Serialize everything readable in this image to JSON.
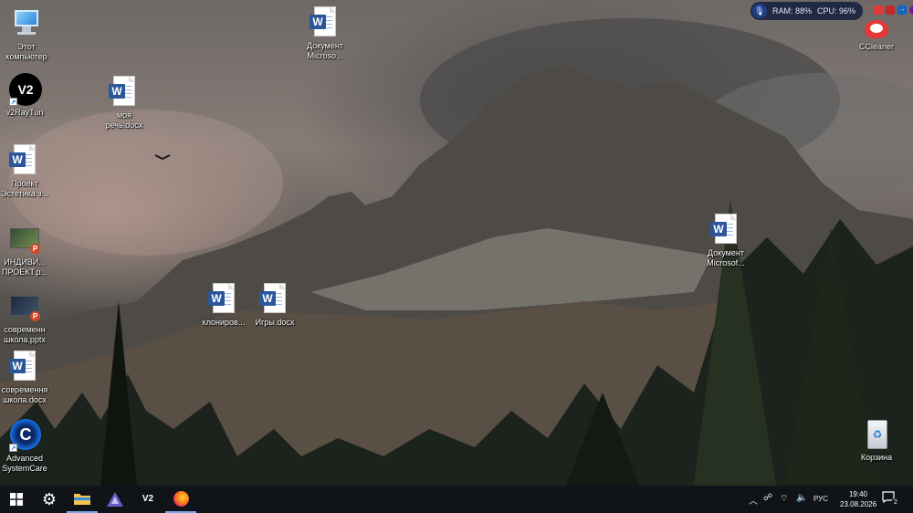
{
  "desktop": {
    "icons": [
      {
        "name": "this-pc",
        "label": "Этот\nкомпьютер"
      },
      {
        "name": "v2raytun",
        "label": "v2RayTun",
        "badge": "V2"
      },
      {
        "name": "proekt-estetika",
        "label": "Проект\nЭстетика з..."
      },
      {
        "name": "individ-proekt",
        "label": "ИНДИВИ...\nПРОЕКТ.р..."
      },
      {
        "name": "sovremennaya-shkola-pptx",
        "label": "современн\nшкола.pptx"
      },
      {
        "name": "sovremennaya-shkola-docx",
        "label": "современня\nшкола.docx"
      },
      {
        "name": "advanced-systemcare",
        "label": "Advanced\nSystemCare"
      },
      {
        "name": "moya-rech",
        "label": "моя\nречь.docx"
      },
      {
        "name": "dokument-microsoft-top",
        "label": "Документ\nMicroso..."
      },
      {
        "name": "klonirov",
        "label": "клониров..."
      },
      {
        "name": "igry",
        "label": "Игры.docx"
      },
      {
        "name": "dokument-microsoft-right",
        "label": "Документ\nMicrosof..."
      },
      {
        "name": "ccleaner",
        "label": "CCleaner"
      },
      {
        "name": "recycle-bin",
        "label": "Корзина"
      }
    ]
  },
  "sysmon": {
    "ram": "RAM: 88%",
    "cpu": "CPU: 96%"
  },
  "taskbar": {
    "pinned": [
      {
        "icon": "windows-start-icon"
      },
      {
        "icon": "settings-gear-icon"
      },
      {
        "icon": "file-explorer-icon"
      },
      {
        "icon": "app-icon"
      },
      {
        "icon": "v2raytun-icon",
        "label": "V2"
      },
      {
        "icon": "firefox-icon"
      }
    ],
    "language": "РУС",
    "time": "19:40",
    "date": "23.08.2026",
    "notification_count": "2"
  },
  "colors": {
    "word_blue": "#2b579a",
    "taskbar": "#101317",
    "accent": "#7aa7e8"
  }
}
